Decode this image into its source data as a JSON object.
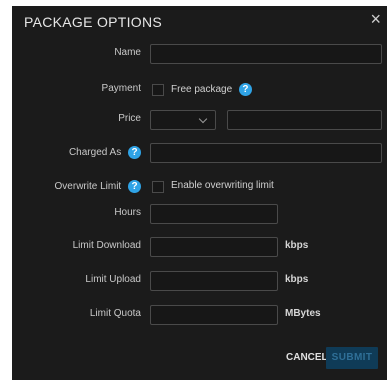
{
  "dialog": {
    "title": "PACKAGE OPTIONS",
    "close_icon": "×"
  },
  "fields": {
    "name": {
      "label": "Name",
      "value": ""
    },
    "payment": {
      "label": "Payment",
      "checkbox_label": "Free package",
      "checked": false
    },
    "price": {
      "label": "Price",
      "currency_selected": "",
      "value": ""
    },
    "charged_as": {
      "label": "Charged As",
      "value": ""
    },
    "overwrite_limit": {
      "label": "Overwrite Limit",
      "checkbox_label": "Enable overwriting limit",
      "checked": false
    },
    "hours": {
      "label": "Hours",
      "value": ""
    },
    "limit_download": {
      "label": "Limit Download",
      "value": "",
      "unit": "kbps"
    },
    "limit_upload": {
      "label": "Limit Upload",
      "value": "",
      "unit": "kbps"
    },
    "limit_quota": {
      "label": "Limit Quota",
      "value": "",
      "unit": "MBytes"
    }
  },
  "help_glyph": "?",
  "actions": {
    "cancel_label": "CANCEL",
    "submit_label": "SUBMIT"
  },
  "colors": {
    "dialog_bg": "#1b1b1b",
    "help_icon": "#2fa3e6",
    "submit_bg": "#0f3b57"
  }
}
